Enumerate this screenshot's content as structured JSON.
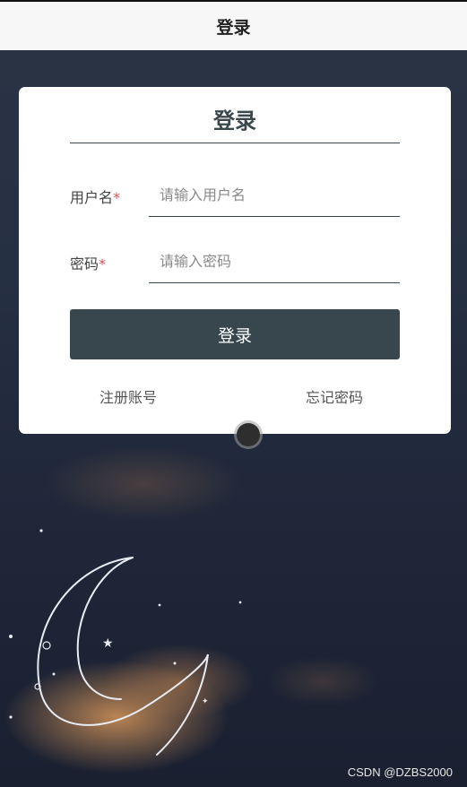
{
  "header": {
    "title": "登录"
  },
  "login_card": {
    "title": "登录",
    "username": {
      "label": "用户名",
      "required_mark": "*",
      "placeholder": "请输入用户名",
      "value": ""
    },
    "password": {
      "label": "密码",
      "required_mark": "*",
      "placeholder": "请输入密码",
      "value": ""
    },
    "submit_label": "登录",
    "register_link": "注册账号",
    "forgot_link": "忘记密码"
  },
  "watermark": "CSDN @DZBS2000",
  "colors": {
    "primary": "#37474d",
    "required": "#d9534f",
    "header_bg": "#f7f7f7",
    "card_bg": "#ffffff"
  }
}
